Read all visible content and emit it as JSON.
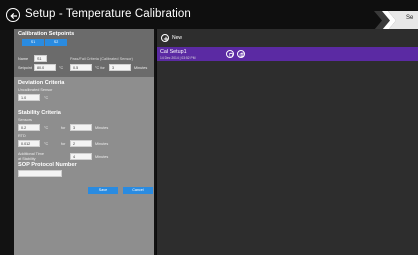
{
  "header": {
    "title": "Setup  -  Temperature  Calibration",
    "breadcrumb_tab": "Se"
  },
  "form": {
    "calibration_setpoints": {
      "heading": "Calibration Setpoints",
      "tabs": [
        "S1",
        "S2"
      ],
      "name_label": "Name",
      "name_value": "S1",
      "reference_label": "Setpoint",
      "reference_value": "80.0",
      "reference_unit": "°C",
      "range_label": "Pass/Fail Criteria (Calibrated Sensor)",
      "range_from": "0.5",
      "range_to_label": "°C for",
      "range_minutes": "3",
      "range_minutes_unit": "Minutes"
    },
    "deviation_criteria": {
      "heading": "Deviation Criteria",
      "label": "Uncalibrated Sensor",
      "value": "1.0",
      "unit": "°C"
    },
    "stability_criteria": {
      "heading": "Stability Criteria",
      "sensors_label": "Sensors",
      "sensors_value": "0.2",
      "sensors_unit": "°C",
      "sensors_for": "for",
      "sensors_minutes": "3",
      "sensors_minutes_unit": "Minutes",
      "rtd_label": "RTD",
      "rtd_value": "0.012",
      "rtd_unit": "°C",
      "rtd_for": "for",
      "rtd_minutes": "2",
      "rtd_minutes_unit": "Minutes",
      "additional_label_1": "Additional Time",
      "additional_label_2": "at Stability",
      "additional_value": "4",
      "additional_unit": "Minutes"
    },
    "sop": {
      "heading": "SOP Protocol Number",
      "value": ""
    },
    "save_label": "Save",
    "cancel_label": "Cancel"
  },
  "list": {
    "new_label": "New",
    "items": [
      {
        "title": "Cal Setup1",
        "date": "14 Dec 2014 | 03:52 PM"
      }
    ]
  },
  "colors": {
    "accent_blue": "#2a8be0",
    "selected_purple": "#5b2aa3",
    "form_bg": "#8e8e8e"
  },
  "icons": [
    "back-arrow-icon",
    "plus-icon",
    "delete-icon",
    "copy-icon"
  ]
}
